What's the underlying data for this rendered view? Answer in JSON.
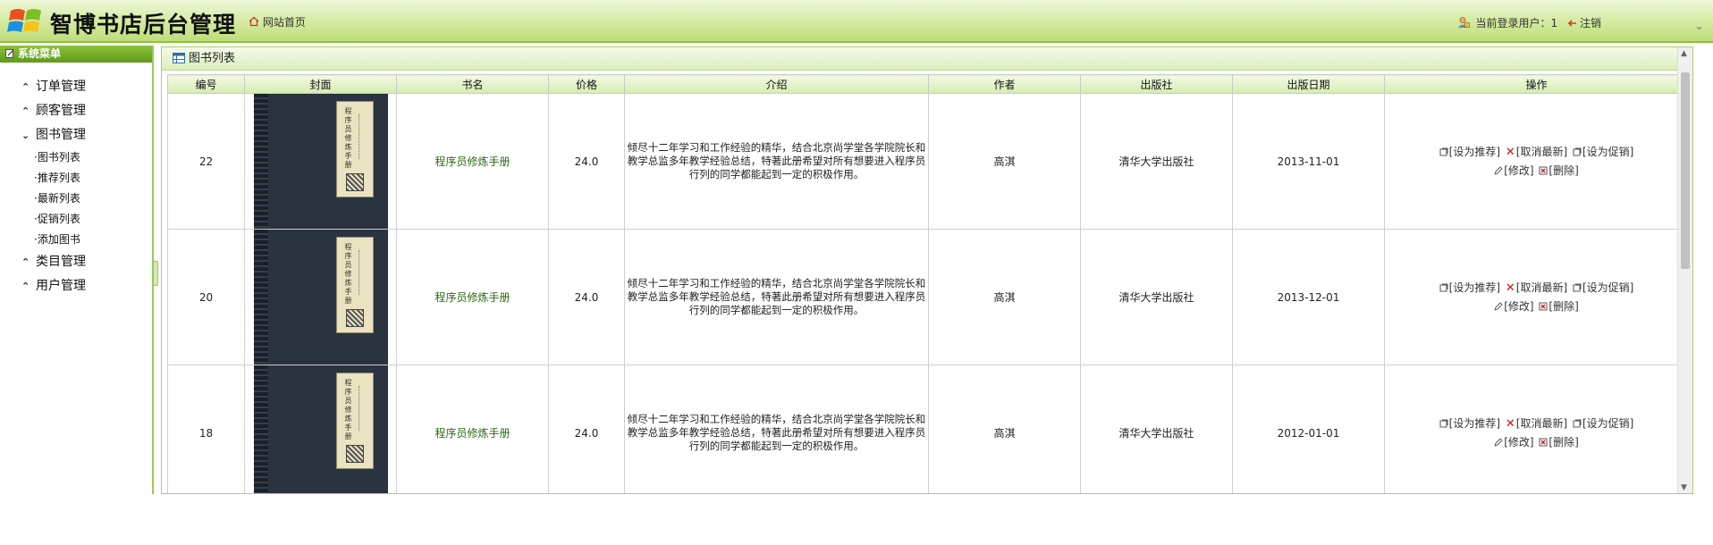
{
  "header": {
    "title": "智博书店后台管理",
    "home_link": "网站首页",
    "current_user_label": "当前登录用户：1",
    "logout": "注销",
    "logo_icon": "windows-logo-icon"
  },
  "sidebar": {
    "title": "系统菜单",
    "groups": [
      {
        "label": "订单管理",
        "expanded": false
      },
      {
        "label": "顾客管理",
        "expanded": false
      },
      {
        "label": "图书管理",
        "expanded": true,
        "items": [
          "·图书列表",
          "·推荐列表",
          "·最新列表",
          "·促销列表",
          "·添加图书"
        ]
      },
      {
        "label": "类目管理",
        "expanded": false
      },
      {
        "label": "用户管理",
        "expanded": false
      }
    ]
  },
  "main": {
    "panel_title": "图书列表",
    "columns": [
      "编号",
      "封面",
      "书名",
      "价格",
      "介绍",
      "作者",
      "出版社",
      "出版日期",
      "操作"
    ],
    "rows": [
      {
        "id": "22",
        "cover_title": "程序员修炼手册",
        "name": "程序员修炼手册",
        "price": "24.0",
        "intro": "倾尽十二年学习和工作经验的精华，结合北京尚学堂各学院院长和教学总监多年教学经验总结，特著此册希望对所有想要进入程序员行列的同学都能起到一定的积极作用。",
        "author": "高淇",
        "publisher": "清华大学出版社",
        "date": "2013-11-01"
      },
      {
        "id": "20",
        "cover_title": "程序员修炼手册",
        "name": "程序员修炼手册",
        "price": "24.0",
        "intro": "倾尽十二年学习和工作经验的精华，结合北京尚学堂各学院院长和教学总监多年教学经验总结，特著此册希望对所有想要进入程序员行列的同学都能起到一定的积极作用。",
        "author": "高淇",
        "publisher": "清华大学出版社",
        "date": "2013-12-01"
      },
      {
        "id": "18",
        "cover_title": "程序员修炼手册",
        "name": "程序员修炼手册",
        "price": "24.0",
        "intro": "倾尽十二年学习和工作经验的精华，结合北京尚学堂各学院院长和教学总监多年教学经验总结，特著此册希望对所有想要进入程序员行列的同学都能起到一定的积极作用。",
        "author": "高淇",
        "publisher": "清华大学出版社",
        "date": "2012-01-01"
      }
    ],
    "ops": {
      "set_recommend": "[设为推荐]",
      "cancel_new": "[取消最新]",
      "set_promo": "[设为促销]",
      "edit": "[修改]",
      "delete": "[删除]"
    }
  },
  "colors": {
    "accent_green": "#8fbf3a",
    "header_gradient_top": "#eef7d9",
    "header_gradient_bottom": "#bedd7a",
    "sidebar_header": "#5f9a1c",
    "delete_red": "#d01010"
  }
}
